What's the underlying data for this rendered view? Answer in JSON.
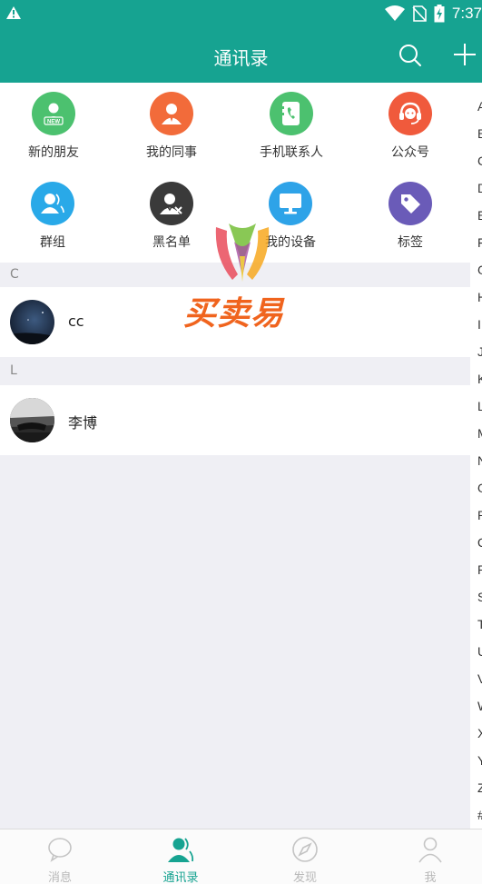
{
  "status_bar": {
    "time": "7:37",
    "icons": [
      "warning-icon",
      "wifi-icon",
      "no-sim-icon",
      "battery-charging-icon"
    ]
  },
  "header": {
    "title": "通讯录",
    "icons": [
      "search-icon",
      "plus-icon"
    ]
  },
  "quick_entries": [
    {
      "label": "新的朋友",
      "icon": "new-friend-icon",
      "color": "#4cc16f"
    },
    {
      "label": "我的同事",
      "icon": "colleague-icon",
      "color": "#f26b3a"
    },
    {
      "label": "手机联系人",
      "icon": "phone-contacts-icon",
      "color": "#4cc16f"
    },
    {
      "label": "公众号",
      "icon": "headset-icon",
      "color": "#f05a3c"
    },
    {
      "label": "群组",
      "icon": "group-icon",
      "color": "#29a9e8"
    },
    {
      "label": "黑名单",
      "icon": "blacklist-icon",
      "color": "#3a3a3a"
    },
    {
      "label": "我的设备",
      "icon": "monitor-icon",
      "color": "#2ea3e8"
    },
    {
      "label": "标签",
      "icon": "tag-icon",
      "color": "#6a5bb8"
    }
  ],
  "watermark": {
    "text": "买卖易"
  },
  "sections": [
    {
      "letter": "C",
      "contacts": [
        {
          "name": "cc"
        }
      ]
    },
    {
      "letter": "L",
      "contacts": [
        {
          "name": "李博"
        }
      ]
    }
  ],
  "index_letters": [
    "A",
    "B",
    "C",
    "D",
    "E",
    "F",
    "G",
    "H",
    "I",
    "J",
    "K",
    "L",
    "M",
    "N",
    "O",
    "P",
    "Q",
    "R",
    "S",
    "T",
    "U",
    "V",
    "W",
    "X",
    "Y",
    "Z",
    "#"
  ],
  "tabs": [
    {
      "label": "消息",
      "icon": "chat-bubble-icon",
      "active": false
    },
    {
      "label": "通讯录",
      "icon": "contacts-icon",
      "active": true
    },
    {
      "label": "发现",
      "icon": "compass-icon",
      "active": false
    },
    {
      "label": "我",
      "icon": "user-icon",
      "active": false
    }
  ],
  "colors": {
    "primary": "#16a391",
    "background": "#efeff4",
    "inactive_tab": "#b8b8b8"
  }
}
